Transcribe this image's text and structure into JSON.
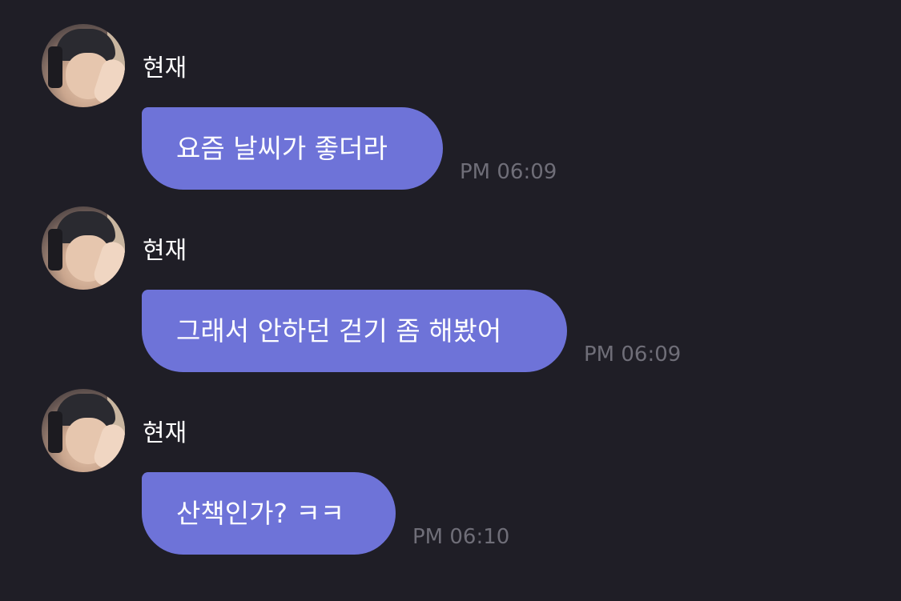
{
  "messages": [
    {
      "sender": "현재",
      "text": "요즘 날씨가 좋더라",
      "time": "PM 06:09"
    },
    {
      "sender": "현재",
      "text": "그래서 안하던 걷기 좀 해봤어",
      "time": "PM 06:09"
    },
    {
      "sender": "현재",
      "text": "산책인가? ㅋㅋ",
      "time": "PM 06:10"
    }
  ],
  "colors": {
    "background": "#1f1e26",
    "bubble": "#6e73d8",
    "name_text": "#ffffff",
    "time_text": "#6f6e78"
  }
}
